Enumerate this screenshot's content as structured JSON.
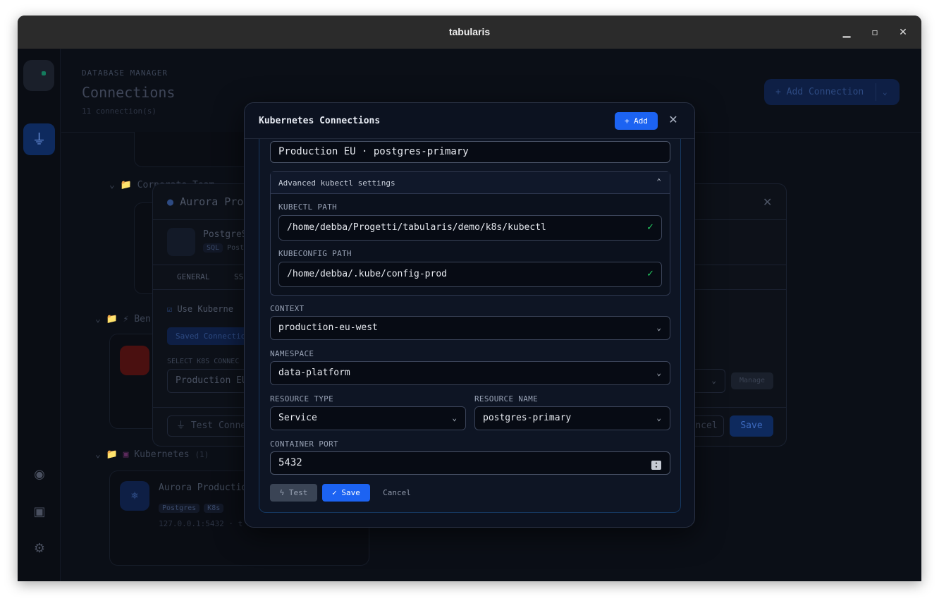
{
  "window": {
    "title": "tabularis"
  },
  "header": {
    "kicker": "DATABASE MANAGER",
    "title": "Connections",
    "count": "11 connection(s)",
    "add_button": "+ Add Connection"
  },
  "background": {
    "groups": [
      {
        "name": "Corporate Team",
        "prefix": "📁"
      },
      {
        "name": "⚡ Ben",
        "prefix": "📁"
      },
      {
        "name": "Kubernetes",
        "count": "(1)",
        "prefix": "📁"
      }
    ],
    "edit_modal": {
      "title": "Aurora Pro",
      "db_name": "PostgreS",
      "db_tag": "SQL",
      "db_sub": "Post",
      "tabs": [
        "GENERAL",
        "SS"
      ],
      "use_k8s": "Use Kuberne",
      "saved_tab": "Saved Connectio",
      "select_label": "SELECT K8S CONNEC",
      "select_value": "Production EU",
      "manage": "Manage",
      "test": "Test Conne",
      "cancel": "ncel",
      "save": "Save"
    },
    "k8s_card": {
      "name": "Aurora Production",
      "tags": [
        "Postgres",
        "K8s"
      ],
      "address": "127.0.0.1:5432 · t"
    }
  },
  "modal": {
    "title": "Kubernetes Connections",
    "add_label": "+ Add",
    "name_value": "Production EU · postgres-primary",
    "advanced": {
      "title": "Advanced kubectl settings",
      "kubectl_label": "KUBECTL PATH",
      "kubectl_value": "/home/debba/Progetti/tabularis/demo/k8s/kubectl",
      "kubeconfig_label": "KUBECONFIG PATH",
      "kubeconfig_value": "/home/debba/.kube/config-prod"
    },
    "context_label": "CONTEXT",
    "context_value": "production-eu-west",
    "namespace_label": "NAMESPACE",
    "namespace_value": "data-platform",
    "resource_type_label": "RESOURCE TYPE",
    "resource_type_value": "Service",
    "resource_name_label": "RESOURCE NAME",
    "resource_name_value": "postgres-primary",
    "port_label": "CONTAINER PORT",
    "port_value": "5432",
    "test_label": "Test",
    "save_label": "Save",
    "cancel_label": "Cancel"
  }
}
